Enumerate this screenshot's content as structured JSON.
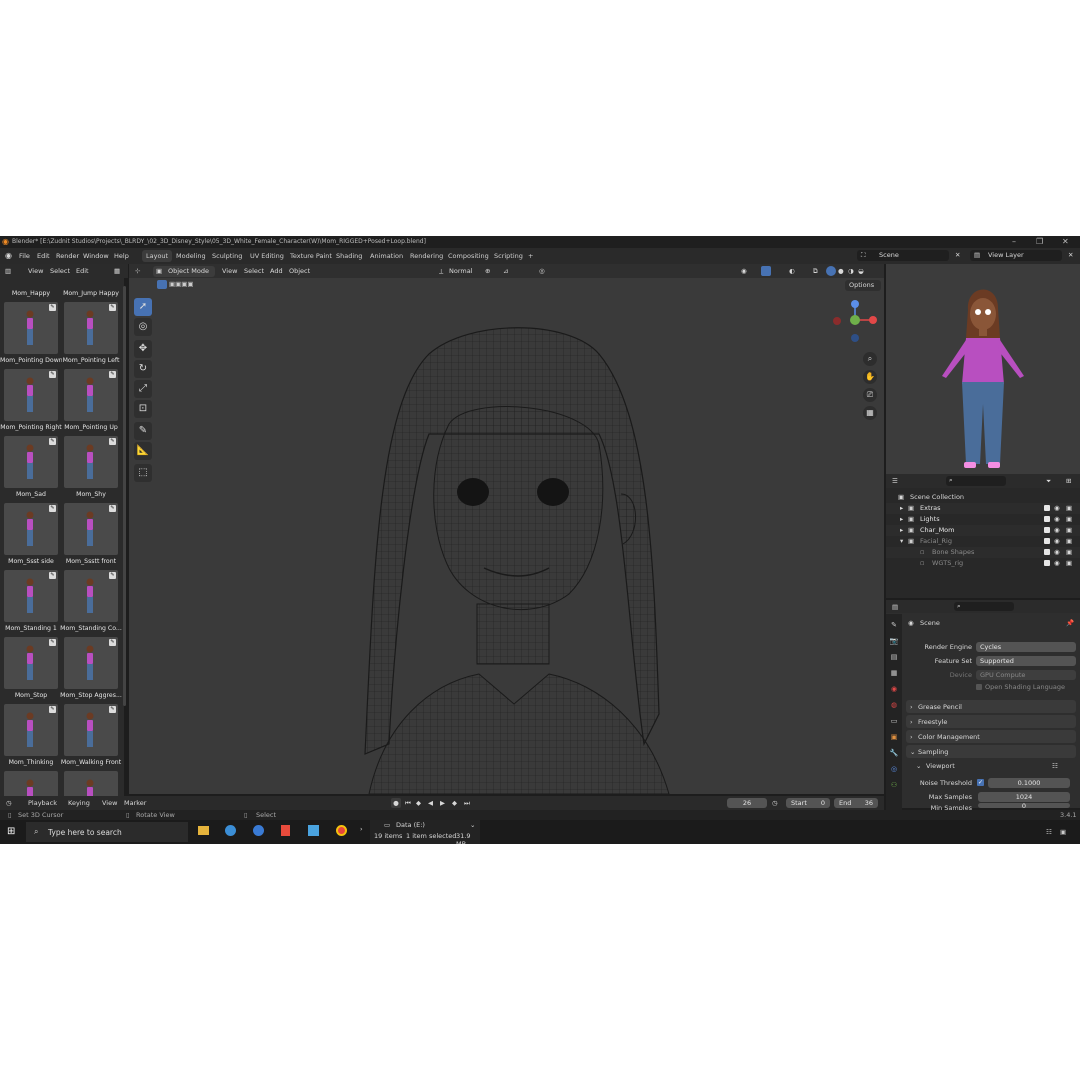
{
  "window": {
    "title": "Blender* [E:\\Zudnit Studios\\Projects\\_BLRDY_\\02_3D_Disney_Style\\05_3D_White_Female_Character(W)\\Mom_RIGGED+Posed+Loop.blend]"
  },
  "menu": {
    "items": [
      "File",
      "Edit",
      "Render",
      "Window",
      "Help"
    ]
  },
  "workspaces": {
    "tabs": [
      "Layout",
      "Modeling",
      "Sculpting",
      "UV Editing",
      "Texture Paint",
      "Shading",
      "Animation",
      "Rendering",
      "Compositing",
      "Scripting"
    ],
    "active": "Layout",
    "add": "+"
  },
  "scene": {
    "label": "Scene",
    "view_layer": "View Layer"
  },
  "asset_browser": {
    "menu": [
      "View",
      "Select",
      "Edit"
    ],
    "items": [
      "Mom_Happy",
      "Mom_Jump Happy",
      "Mom_Pointing Down",
      "Mom_Pointing Left",
      "Mom_Pointing Right",
      "Mom_Pointing Up",
      "Mom_Sad",
      "Mom_Shy",
      "Mom_Ssst side",
      "Mom_Ssstt front",
      "Mom_Standing 1",
      "Mom_Standing Co...",
      "Mom_Stop",
      "Mom_Stop Aggres...",
      "Mom_Thinking",
      "Mom_Walking Front"
    ]
  },
  "viewport": {
    "mode": "Object Mode",
    "menu": [
      "View",
      "Select",
      "Add",
      "Object"
    ],
    "orientation": "Normal",
    "options": "Options"
  },
  "outliner": {
    "root": "Scene Collection",
    "rows": [
      {
        "name": "Extras",
        "depth": 1,
        "expander": "▸"
      },
      {
        "name": "Lights",
        "depth": 1,
        "expander": "▸"
      },
      {
        "name": "Char_Mom",
        "depth": 1,
        "expander": "▸"
      },
      {
        "name": "Facial_Rig",
        "depth": 1,
        "expander": "▾"
      },
      {
        "name": "Bone Shapes",
        "depth": 2,
        "expander": ""
      },
      {
        "name": "WGTS_rig",
        "depth": 2,
        "expander": ""
      }
    ]
  },
  "properties": {
    "context": "Scene",
    "render_engine": {
      "label": "Render Engine",
      "value": "Cycles"
    },
    "feature_set": {
      "label": "Feature Set",
      "value": "Supported"
    },
    "device": {
      "label": "Device",
      "value": "GPU Compute"
    },
    "osl": "Open Shading Language",
    "panels": [
      "Grease Pencil",
      "Freestyle",
      "Color Management",
      "Sampling"
    ],
    "viewport_sub": "Viewport",
    "noise_threshold": {
      "label": "Noise Threshold",
      "value": "0.1000"
    },
    "max_samples": {
      "label": "Max Samples",
      "value": "1024"
    },
    "min_samples": {
      "label": "Min Samples",
      "value": "0"
    }
  },
  "timeline": {
    "menu": [
      "Playback",
      "Keying",
      "View",
      "Marker"
    ],
    "current_frame": "26",
    "start_label": "Start",
    "start": "0",
    "end_label": "End",
    "end": "36"
  },
  "statusbar": {
    "left": "Set 3D Cursor",
    "middle": "Rotate View",
    "right": "Select",
    "version": "3.4.1"
  },
  "taskbar": {
    "search": "Type here to search",
    "explorer": {
      "drive": "Data (E:)",
      "items": "19 items",
      "selected": "1 item selected",
      "size": "31.9 MB"
    }
  },
  "colors": {
    "accent": "#4772b3",
    "shirt": "#b84fc0",
    "jeans": "#4a6d9a",
    "bg": "#1d1d1d"
  }
}
